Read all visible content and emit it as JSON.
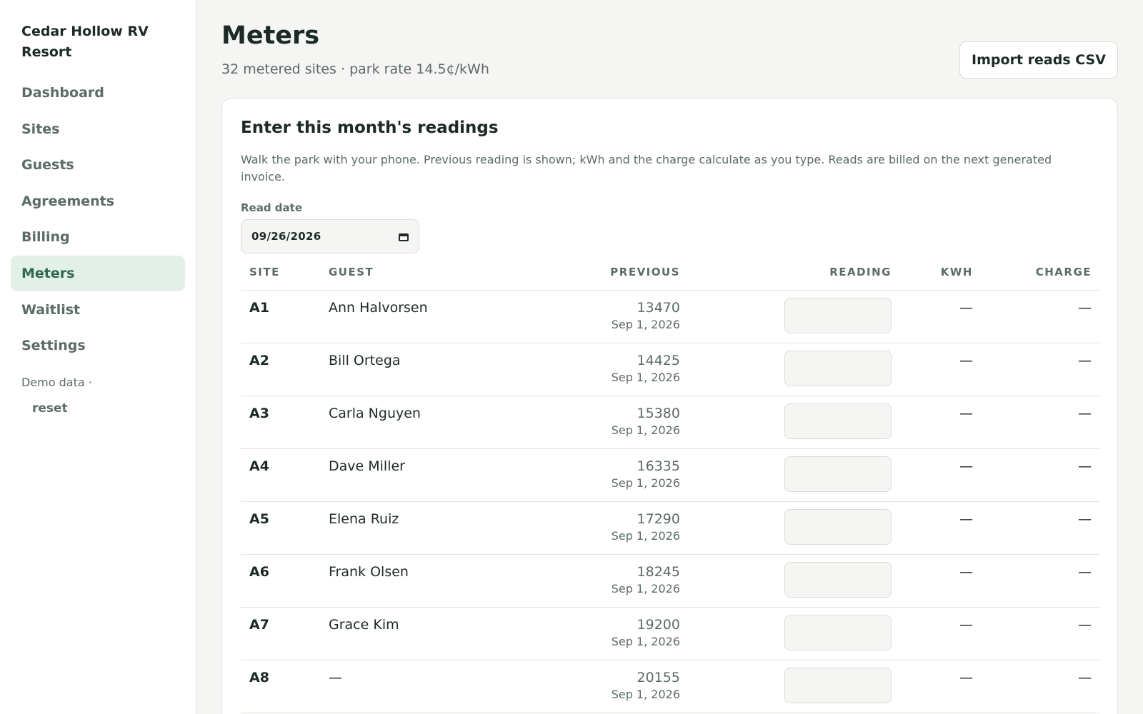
{
  "sidebar": {
    "brand": "Cedar Hollow RV Resort",
    "items": [
      {
        "label": "Dashboard",
        "name": "dashboard"
      },
      {
        "label": "Sites",
        "name": "sites"
      },
      {
        "label": "Guests",
        "name": "guests"
      },
      {
        "label": "Agreements",
        "name": "agreements"
      },
      {
        "label": "Billing",
        "name": "billing"
      },
      {
        "label": "Meters",
        "name": "meters"
      },
      {
        "label": "Waitlist",
        "name": "waitlist"
      },
      {
        "label": "Settings",
        "name": "settings"
      }
    ],
    "active": "Meters",
    "demo_label": "Demo data ·",
    "reset_label": "reset"
  },
  "header": {
    "title": "Meters",
    "subtitle": "32 metered sites · park rate 14.5¢/kWh",
    "import_label": "Import reads CSV"
  },
  "card": {
    "title": "Enter this month's readings",
    "description": "Walk the park with your phone. Previous reading is shown; kWh and the charge calculate as you type. Reads are billed on the next generated invoice.",
    "date_label": "Read date",
    "date_value": "09/26/2026"
  },
  "table": {
    "columns": {
      "site": "SITE",
      "guest": "GUEST",
      "previous": "PREVIOUS",
      "reading": "READING",
      "kwh": "KWH",
      "charge": "CHARGE"
    },
    "rows": [
      {
        "site": "A1",
        "guest": "Ann Halvorsen",
        "previous": "13470",
        "prev_date": "Sep 1, 2026",
        "reading": "",
        "kwh": "—",
        "charge": "—"
      },
      {
        "site": "A2",
        "guest": "Bill Ortega",
        "previous": "14425",
        "prev_date": "Sep 1, 2026",
        "reading": "",
        "kwh": "—",
        "charge": "—"
      },
      {
        "site": "A3",
        "guest": "Carla Nguyen",
        "previous": "15380",
        "prev_date": "Sep 1, 2026",
        "reading": "",
        "kwh": "—",
        "charge": "—"
      },
      {
        "site": "A4",
        "guest": "Dave Miller",
        "previous": "16335",
        "prev_date": "Sep 1, 2026",
        "reading": "",
        "kwh": "—",
        "charge": "—"
      },
      {
        "site": "A5",
        "guest": "Elena Ruiz",
        "previous": "17290",
        "prev_date": "Sep 1, 2026",
        "reading": "",
        "kwh": "—",
        "charge": "—"
      },
      {
        "site": "A6",
        "guest": "Frank Olsen",
        "previous": "18245",
        "prev_date": "Sep 1, 2026",
        "reading": "",
        "kwh": "—",
        "charge": "—"
      },
      {
        "site": "A7",
        "guest": "Grace Kim",
        "previous": "19200",
        "prev_date": "Sep 1, 2026",
        "reading": "",
        "kwh": "—",
        "charge": "—"
      },
      {
        "site": "A8",
        "guest": "—",
        "previous": "20155",
        "prev_date": "Sep 1, 2026",
        "reading": "",
        "kwh": "—",
        "charge": "—"
      }
    ]
  },
  "colors": {
    "accent": "#2d6a4f",
    "active_bg": "#e3f0e8",
    "muted": "#5b6b66"
  }
}
